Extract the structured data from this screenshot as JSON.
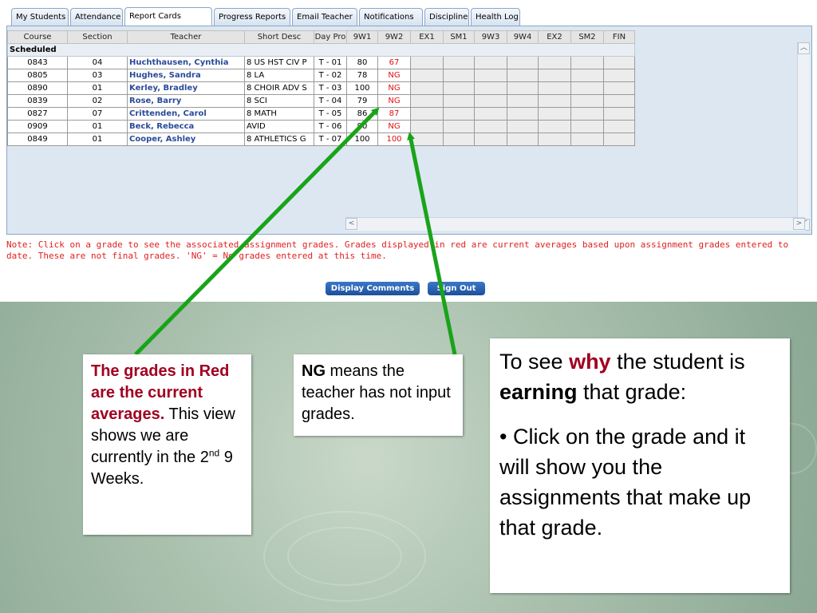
{
  "tabs": [
    "My Students",
    "Attendance",
    "Report Cards",
    "Progress Reports",
    "Email Teacher",
    "Notifications",
    "Discipline",
    "Health Log"
  ],
  "active_tab": "Report Cards",
  "columns": [
    "Course",
    "Section",
    "Teacher",
    "Short Desc",
    "Day Pro",
    "9W1",
    "9W2",
    "EX1",
    "SM1",
    "9W3",
    "9W4",
    "EX2",
    "SM2",
    "FIN"
  ],
  "group_label": "Scheduled",
  "rows": [
    {
      "course": "0843",
      "section": "04",
      "teacher": "Huchthausen, Cynthia",
      "desc": "8 US HST CIV P",
      "day": "T - 01",
      "w1": "80",
      "w2": "67"
    },
    {
      "course": "0805",
      "section": "03",
      "teacher": "Hughes, Sandra",
      "desc": "8 LA",
      "day": "T - 02",
      "w1": "78",
      "w2": "NG"
    },
    {
      "course": "0890",
      "section": "01",
      "teacher": "Kerley, Bradley",
      "desc": "8 CHOIR ADV S",
      "day": "T - 03",
      "w1": "100",
      "w2": "NG"
    },
    {
      "course": "0839",
      "section": "02",
      "teacher": "Rose, Barry",
      "desc": "8 SCI",
      "day": "T - 04",
      "w1": "79",
      "w2": "NG"
    },
    {
      "course": "0827",
      "section": "07",
      "teacher": "Crittenden, Carol",
      "desc": "8 MATH",
      "day": "T - 05",
      "w1": "86",
      "w2": "87"
    },
    {
      "course": "0909",
      "section": "01",
      "teacher": "Beck, Rebecca",
      "desc": "AVID",
      "day": "T - 06",
      "w1": "90",
      "w2": "NG"
    },
    {
      "course": "0849",
      "section": "01",
      "teacher": "Cooper, Ashley",
      "desc": "8 ATHLETICS G",
      "day": "T - 07",
      "w1": "100",
      "w2": "100"
    }
  ],
  "note": "Note: Click on a grade to see the associated assignment grades. Grades displayed in red are current averages based upon assignment grades entered to date. These are not final grades. 'NG' = No grades entered at this time.",
  "buttons": {
    "display_comments": "Display Comments",
    "sign_out": "Sign Out"
  },
  "callout1": {
    "bold": "The grades in Red are the current averages.",
    "text": "This view shows we are currently in the 2",
    "sup": "nd",
    "tail": " 9 Weeks."
  },
  "callout2": {
    "bold": "NG",
    "text": " means the teacher has not input grades."
  },
  "callout3": {
    "line1_a": "To see ",
    "line1_b": "why",
    "line1_c": " the student is ",
    "line1_d": "earning",
    "line1_e": " that grade:",
    "bullet": "• Click on the grade and it will show you the assignments that make up that grade."
  },
  "colors": {
    "accent_red": "#e01010",
    "teacher_blue": "#2a4a9a",
    "arrow_green": "#1aa31a",
    "maroon": "#a00020"
  }
}
